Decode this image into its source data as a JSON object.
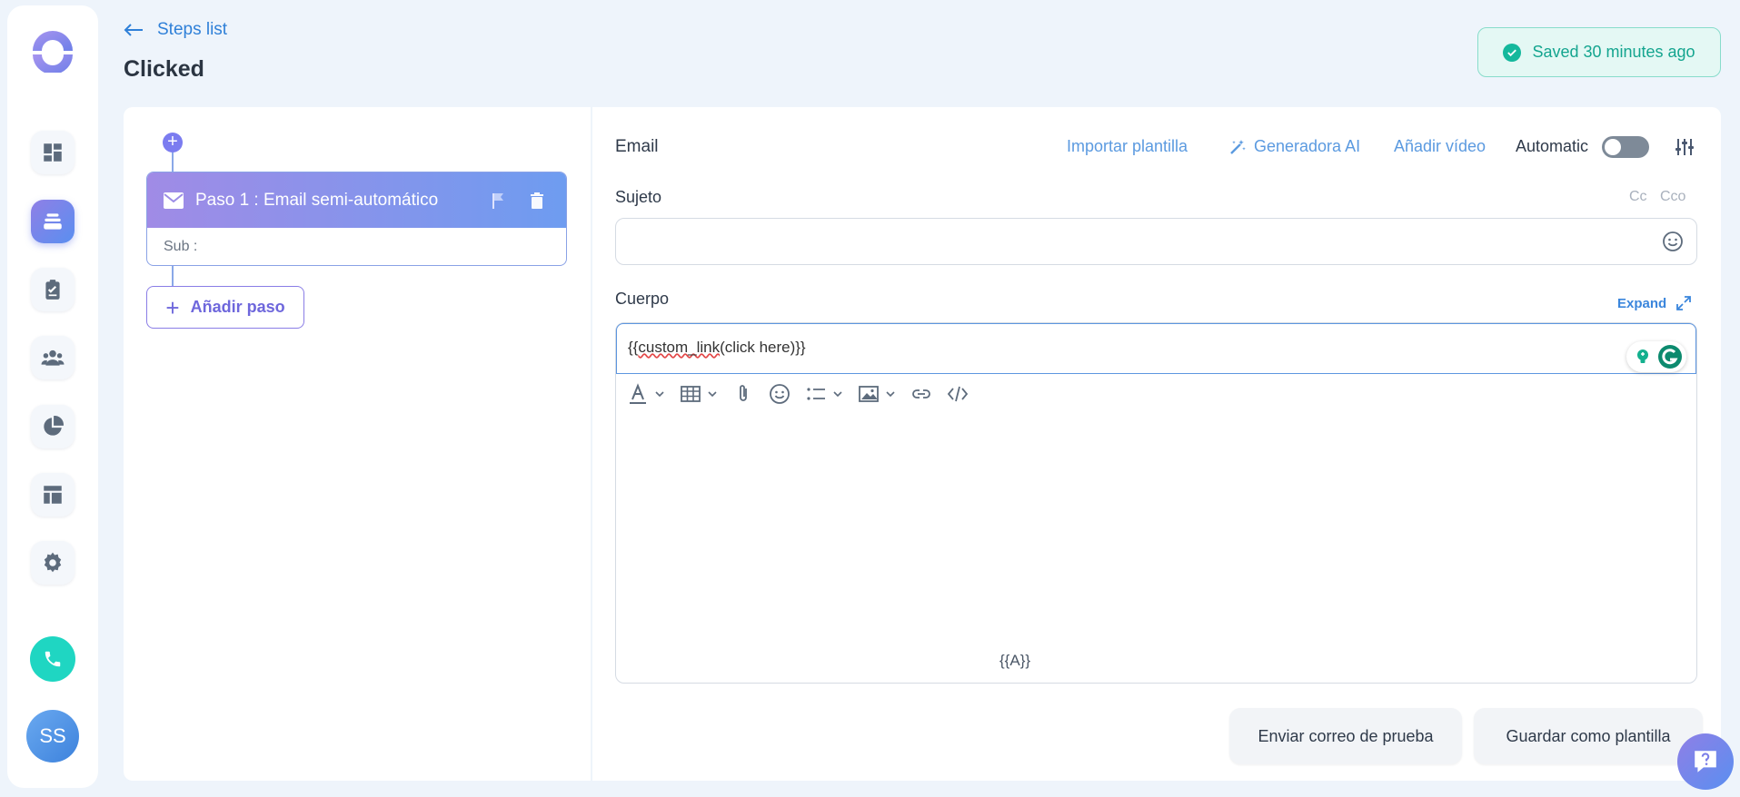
{
  "colors": {
    "accent": "#5a8ff0",
    "brand_purple": "#8f7fe6",
    "success": "#14b89c",
    "link": "#2f80d8"
  },
  "sidebar": {
    "items": [
      {
        "icon": "dashboard-icon"
      },
      {
        "icon": "sequences-icon",
        "active": true
      },
      {
        "icon": "clipboard-icon"
      },
      {
        "icon": "contacts-icon"
      },
      {
        "icon": "pie-chart-icon"
      },
      {
        "icon": "template-icon"
      },
      {
        "icon": "gear-icon"
      }
    ],
    "avatar_initials": "SS"
  },
  "header": {
    "back_label": "Steps list",
    "title": "Clicked",
    "saved_status": "Saved 30 minutes ago"
  },
  "steps": {
    "step1_title": "Paso 1 : Email semi-automático",
    "step1_sub": "Sub :",
    "add_step_label": "Añadir paso"
  },
  "editor": {
    "type_label": "Email",
    "import_template": "Importar plantilla",
    "ai_generator": "Generadora AI",
    "add_video": "Añadir vídeo",
    "automatic_label": "Automatic",
    "automatic_on": false,
    "subject_label": "Sujeto",
    "cc_label": "Cc",
    "bcc_label": "Cco",
    "subject_value": "",
    "body_label": "Cuerpo",
    "expand_label": "Expand",
    "body_prefix": "{{",
    "body_link": "custom_link",
    "body_suffix": "(click here)}}",
    "variable_button": "{{A}}",
    "send_test": "Enviar correo de prueba",
    "save_template": "Guardar como plantilla"
  }
}
